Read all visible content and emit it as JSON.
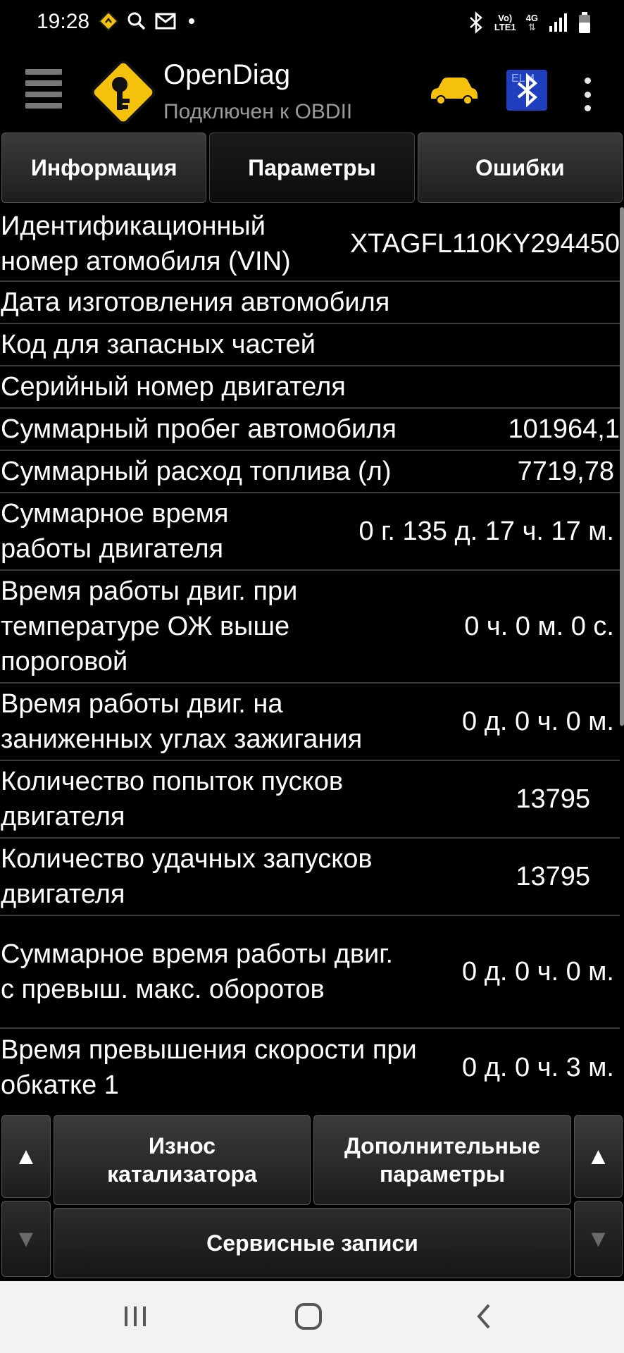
{
  "status_bar": {
    "time": "19:28",
    "network_top": "Vo)",
    "network_bottom": "LTE1",
    "network_type": "4G",
    "icons": [
      "navigation-icon",
      "search-icon",
      "mail-icon",
      "bluetooth-icon",
      "signal-icon",
      "battery-icon"
    ]
  },
  "app_bar": {
    "title": "OpenDiag",
    "subtitle": "Подключен к OBDII",
    "logo_color": "#f4c20d",
    "car_color": "#f4c20d",
    "bt_label": "ELM"
  },
  "tabs": [
    {
      "label": "Информация",
      "active": false
    },
    {
      "label": "Параметры",
      "active": true
    },
    {
      "label": "Ошибки",
      "active": false
    }
  ],
  "parameters": [
    {
      "label": "Идентификационный номер атомобиля (VIN)",
      "value": "XTAGFL110KY294450"
    },
    {
      "label": "Дата изготовления автомобиля",
      "value": ""
    },
    {
      "label": "Код для запасных частей",
      "value": ""
    },
    {
      "label": "Серийный номер двигателя",
      "value": ""
    },
    {
      "label": "Суммарный пробег автомобиля",
      "value": "101964,1"
    },
    {
      "label": "Суммарный расход топлива (л)",
      "value": "7719,78"
    },
    {
      "label": "Суммарное время работы двигателя",
      "value": "0 г. 135 д. 17 ч. 17 м."
    },
    {
      "label": "Время работы двиг. при температуре ОЖ выше пороговой",
      "value": "0 ч. 0 м. 0 с."
    },
    {
      "label": "Время работы двиг. на заниженных углах зажигания",
      "value": "0 д. 0 ч. 0 м."
    },
    {
      "label": "Количество попыток пусков двигателя",
      "value": "13795"
    },
    {
      "label": "Количество удачных запусков двигателя",
      "value": "13795"
    },
    {
      "label": "Суммарное время работы двиг. с превыш. макс. оборотов",
      "value": "0 д. 0 ч. 0 м."
    },
    {
      "label": "Время превышения скорости при обкатке 1",
      "value": "0 д. 0 ч. 3 м."
    }
  ],
  "bottom": {
    "up_symbol": "▲",
    "down_symbol": "▼",
    "catalyst_label": "Износ катализатора",
    "extra_label": "Дополнительные параметры",
    "service_label": "Сервисные записи"
  }
}
